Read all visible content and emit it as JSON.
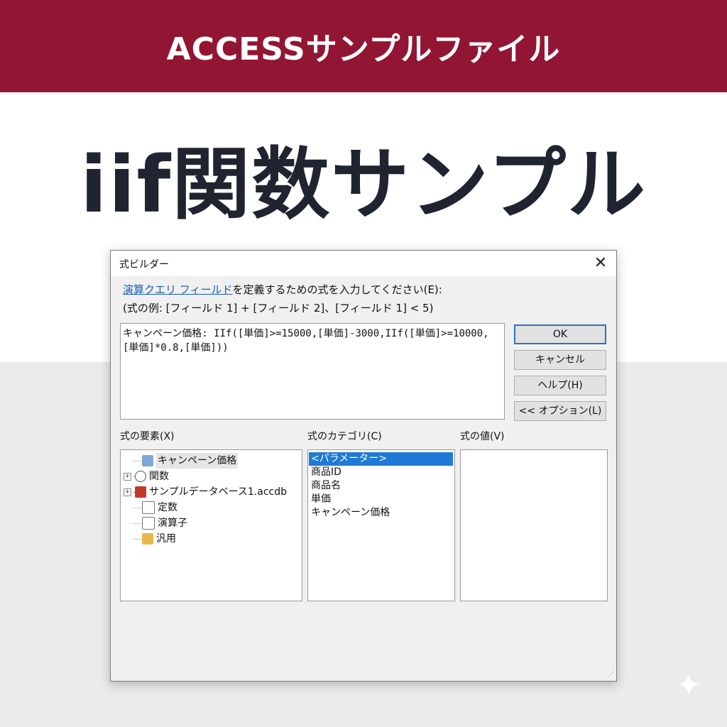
{
  "banner": {
    "text": "ACCESSサンプルファイル",
    "color": "#921633"
  },
  "hero": {
    "title": "iif関数サンプル"
  },
  "dialog": {
    "title": "式ビルダー",
    "close_icon": "close-icon",
    "description_link": "演算クエリ フィールド",
    "description_rest": "を定義するための式を入力してください(E):",
    "example": "(式の例: [フィールド 1] + [フィールド 2]、[フィールド 1] < 5)",
    "expression": "キャンペーン価格: IIf([単価]>=15000,[単価]-3000,IIf([単価]>=10000,[単価]*0.8,[単価]))",
    "buttons": {
      "ok": "OK",
      "cancel": "キャンセル",
      "help": "ヘルプ(H)",
      "options": "<< オプション(L)"
    },
    "elements_label": "式の要素(X)",
    "categories_label": "式のカテゴリ(C)",
    "values_label": "式の値(V)",
    "elements": [
      {
        "label": "キャンペーン価格",
        "icon": "form-field-icon",
        "expandable": false,
        "selected": true
      },
      {
        "label": "関数",
        "icon": "function-icon",
        "expandable": true,
        "selected": false
      },
      {
        "label": "サンプルデータベース1.accdb",
        "icon": "database-icon",
        "expandable": true,
        "selected": false
      },
      {
        "label": "定数",
        "icon": "constant-icon",
        "expandable": false,
        "selected": false
      },
      {
        "label": "演算子",
        "icon": "operator-icon",
        "expandable": false,
        "selected": false
      },
      {
        "label": "汎用",
        "icon": "common-icon",
        "expandable": false,
        "selected": false
      }
    ],
    "categories": [
      {
        "label": "<パラメーター>",
        "selected": true
      },
      {
        "label": "商品ID",
        "selected": false
      },
      {
        "label": "商品名",
        "selected": false
      },
      {
        "label": "単価",
        "selected": false
      },
      {
        "label": "キャンペーン価格",
        "selected": false
      }
    ],
    "values": []
  }
}
